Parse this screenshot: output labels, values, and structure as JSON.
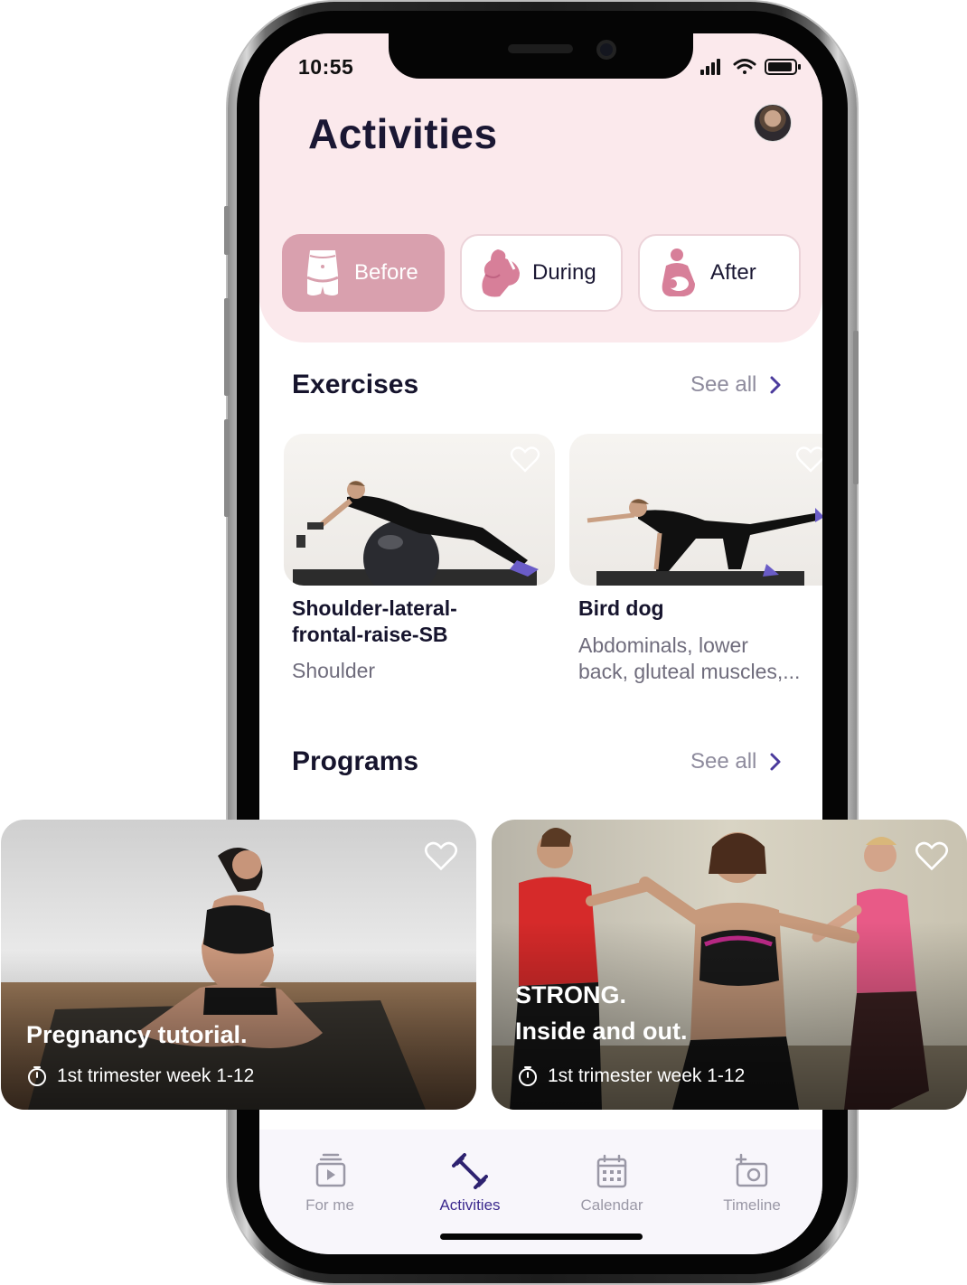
{
  "status": {
    "time": "10:55"
  },
  "header": {
    "title": "Activities"
  },
  "segments": [
    {
      "label": "Before",
      "icon": "belly-icon",
      "active": true
    },
    {
      "label": "During",
      "icon": "pregnant-icon",
      "active": false
    },
    {
      "label": "After",
      "icon": "mother-baby-icon",
      "active": false
    }
  ],
  "exercises": {
    "title": "Exercises",
    "see_all": "See all",
    "items": [
      {
        "title_line1": "Shoulder-lateral-",
        "title_line2": "frontal-raise-SB",
        "subtitle_line1": "Shoulder",
        "subtitle_line2": ""
      },
      {
        "title_line1": "Bird dog",
        "title_line2": "",
        "subtitle_line1": "Abdominals, lower",
        "subtitle_line2": "back, gluteal muscles,..."
      }
    ]
  },
  "programs": {
    "title": "Programs",
    "see_all": "See all",
    "items": [
      {
        "title_line1": "Pregnancy tutorial.",
        "title_line2": "",
        "meta": "1st trimester week 1-12"
      },
      {
        "title_line1": "STRONG.",
        "title_line2": "Inside and out.",
        "meta": "1st trimester week 1-12"
      }
    ]
  },
  "tabbar": {
    "items": [
      {
        "label": "For me",
        "icon": "play-stack-icon",
        "active": false
      },
      {
        "label": "Activities",
        "icon": "dumbbell-icon",
        "active": true
      },
      {
        "label": "Calendar",
        "icon": "calendar-icon",
        "active": false
      },
      {
        "label": "Timeline",
        "icon": "camera-plus-icon",
        "active": false
      }
    ]
  },
  "colors": {
    "header_bg": "#fbe9ec",
    "active_segment": "#d9a0ae",
    "accent": "#3c2a8e",
    "title_text": "#1a1733"
  }
}
